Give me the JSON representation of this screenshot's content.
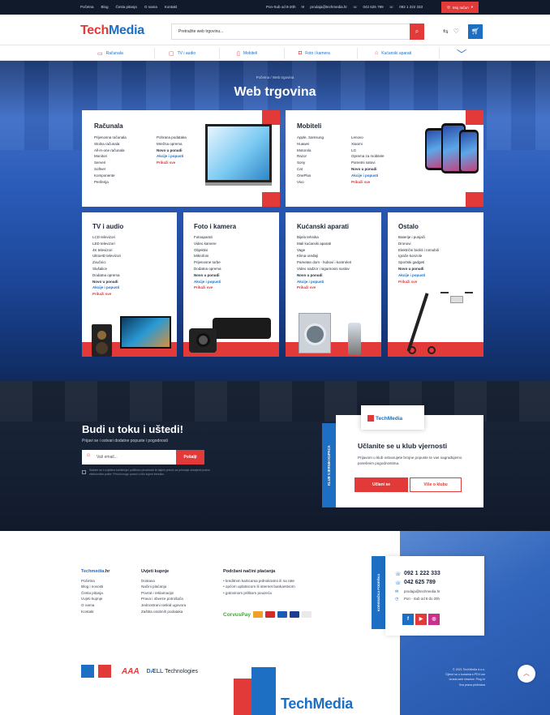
{
  "topbar": {
    "nav": [
      "Početna",
      "Blog",
      "Česta pitanja",
      "O nama",
      "Kontakt"
    ],
    "hours": "Pon-Sub od 8-20h",
    "email": "prodaja@techmedia.hr",
    "phone1": "042 625 789",
    "phone2": "092 1 222 333",
    "account_label": "Moj račun"
  },
  "header": {
    "logo_part1": "Tech",
    "logo_part2": "Media",
    "search_placeholder": "Pretražite web trgovinu..."
  },
  "catnav": [
    {
      "label": "Računala"
    },
    {
      "label": "TV i audio"
    },
    {
      "label": "Mobiteli"
    },
    {
      "label": "Foto i kamera"
    },
    {
      "label": "Kućanski aparati"
    }
  ],
  "hero": {
    "breadcrumb": "Početna / Web trgovina",
    "title": "Web trgovina"
  },
  "categories": {
    "racunala": {
      "title": "Računala",
      "col1": [
        "Prijenosna računala",
        "Stolna računala",
        "All-in-one računala",
        "Monitori",
        "Serveri",
        "Softver",
        "Komponente",
        "Periferija"
      ],
      "col2": [
        "Pohrana podataka",
        "Mrežna oprema"
      ],
      "new": "Novo u ponudi",
      "promo": "Akcije i popusti",
      "all": "Prikaži sve"
    },
    "mobiteli": {
      "title": "Mobiteli",
      "col1": [
        "Apple, Samsung",
        "Huawei",
        "Motorola",
        "Razor",
        "Sony",
        "Cat",
        "OnePlus",
        "Vivo"
      ],
      "col2": [
        "Lenovo",
        "Xiaomi",
        "LG",
        "Oprema za mobitele",
        "Pametni satovi"
      ],
      "new": "Novo u ponudi",
      "promo": "Akcije i popusti",
      "all": "Prikaži sve"
    },
    "tv": {
      "title": "TV i audio",
      "items": [
        "LCD televizori",
        "LED televizori",
        "4K televizori",
        "UltraHD televizori",
        "Zvučnici",
        "Slušalice",
        "Dodatna oprema"
      ],
      "new": "Novo u ponudi",
      "promo": "Akcije i popusti",
      "all": "Prikaži sve"
    },
    "foto": {
      "title": "Foto i kamera",
      "items": [
        "Fotoaparati",
        "Video kamere",
        "Objektivi",
        "Mikrofoni",
        "Prijenosne torbe",
        "Dodatna oprema"
      ],
      "new": "Novo u ponudi",
      "promo": "Akcije i popusti",
      "all": "Prikaži sve"
    },
    "kucanski": {
      "title": "Kućanski aparati",
      "items": [
        "Bijela tehnika",
        "Mali kućanski aparati",
        "Vage",
        "Klima uređaji",
        "Pametan dom - hubovi i kontroleri",
        "Video nadzor i sigurnosni sustav"
      ],
      "new": "Novo u ponudi",
      "promo": "Akcije i popusti",
      "all": "Prikaži sve"
    },
    "ostalo": {
      "title": "Ostalo",
      "items": [
        "Baterije i punjači",
        "Dronovi",
        "Električni bicikli i romobili",
        "Igrače konzole",
        "Sportski gadgeti"
      ],
      "new": "Novo u ponudi",
      "promo": "Akcije i popusti",
      "all": "Prikaži sve"
    }
  },
  "newsletter": {
    "title": "Budi u toku i uštedi!",
    "subtitle": "Prijavi se i ostvari dodatne popuste i pogodnosti",
    "placeholder": "Vaš email...",
    "button": "Pošalji",
    "terms": "Slažem se s uvjetima korištenja i politikom privatnosti te dajem privolu za primanje obavijesti putem elektroničke pošte. Privolu mogu povući u bilo kojem trenutku."
  },
  "club": {
    "tab": "KLUB VJERNIH KUPACA",
    "logo": "TechMedia",
    "title": "Učlanite se u klub vjernosti",
    "desc": "Prijavom u klub ostvarujete brojne popuste te vas nagrađujemo posebnim pogodnostima.",
    "btn1": "Učlani se",
    "btn2": "Više o klubu"
  },
  "footer": {
    "col1_title_a": "Techmedia",
    "col1_title_b": ".hr",
    "col1": [
      "Početna",
      "Blog i novosti",
      "Česta pitanja",
      "Uvjeti kupnje",
      "O nama",
      "Kontakt"
    ],
    "col2_title": "Uvjeti kupnje",
    "col2": [
      "Dostava",
      "Načini plaćanja",
      "Povrat i reklamacije",
      "Prava i obveze potrošača",
      "Jednostrani raskid ugovora",
      "Zaštita osobnih podataka"
    ],
    "col3_title": "Podržani načini plaćanja",
    "col3": [
      "kreditnim karticama jednokratno ili na rate",
      "općom uplatnicom ili internet bankarstvom",
      "gotovinom prilikom pouzeća"
    ],
    "pay_brand": "CorvusPay",
    "contact_tab": "KORISNIČKA PODRŠKA",
    "phone1": "092 1 222 333",
    "phone2": "042 625 789",
    "email": "prodaja@techmedia.hr",
    "hours": "Pon - Sub od 8 do 20h",
    "copyright": [
      "© 2021 TechMedia d.o.o.",
      "Cijene su u kunama s PDV-om",
      "Izrada web stranice: Plug.hr",
      "Sva prava pridržana"
    ],
    "partner_aaa": "AAA",
    "partner_dell_a": "DÆLL",
    "partner_dell_b": "Technologies",
    "big_name": "TechMedia"
  },
  "colors": {
    "red": "#e23939",
    "blue": "#1d6fc4",
    "navy": "#111a2b"
  }
}
